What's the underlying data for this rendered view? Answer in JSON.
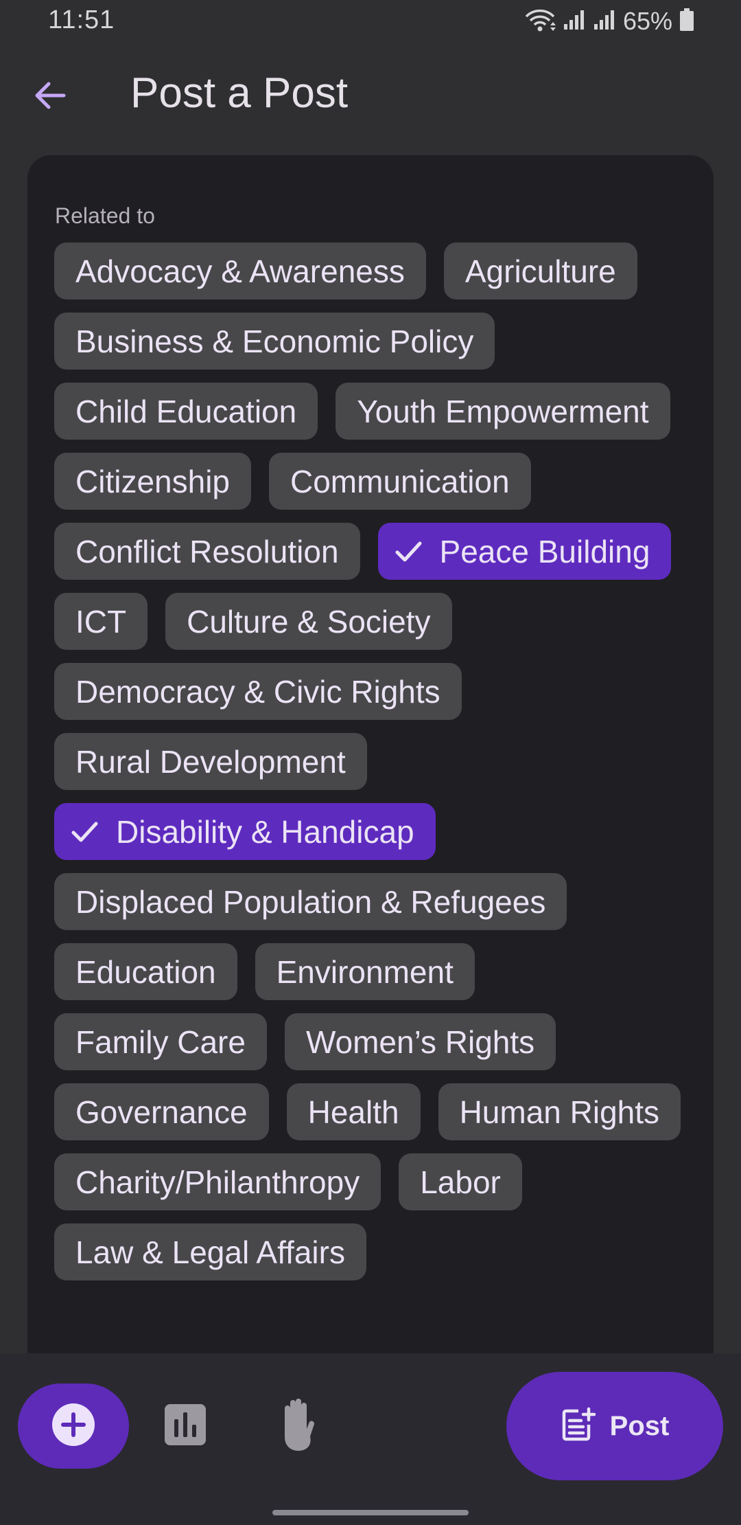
{
  "status_bar": {
    "time": "11:51",
    "battery": "65%"
  },
  "header": {
    "title": "Post a Post",
    "back_icon": "arrow-back-icon"
  },
  "form": {
    "related_label": "Related to",
    "chips": [
      {
        "label": "Advocacy & Awareness",
        "selected": false
      },
      {
        "label": "Agriculture",
        "selected": false
      },
      {
        "label": "Business & Economic Policy",
        "selected": false
      },
      {
        "label": "Child Education",
        "selected": false
      },
      {
        "label": "Youth Empowerment",
        "selected": false
      },
      {
        "label": "Citizenship",
        "selected": false
      },
      {
        "label": "Communication",
        "selected": false
      },
      {
        "label": "Conflict Resolution",
        "selected": false
      },
      {
        "label": "Peace Building",
        "selected": true
      },
      {
        "label": "ICT",
        "selected": false
      },
      {
        "label": "Culture & Society",
        "selected": false
      },
      {
        "label": "Democracy & Civic Rights",
        "selected": false
      },
      {
        "label": "Rural Development",
        "selected": false
      },
      {
        "label": "Disability & Handicap",
        "selected": true
      },
      {
        "label": "Displaced Population & Refugees",
        "selected": false
      },
      {
        "label": "Education",
        "selected": false
      },
      {
        "label": "Environment",
        "selected": false
      },
      {
        "label": "Family Care",
        "selected": false
      },
      {
        "label": "Women’s Rights",
        "selected": false
      },
      {
        "label": "Governance",
        "selected": false
      },
      {
        "label": "Health",
        "selected": false
      },
      {
        "label": "Human Rights",
        "selected": false
      },
      {
        "label": "Charity/Philanthropy",
        "selected": false
      },
      {
        "label": "Labor",
        "selected": false
      },
      {
        "label": "Law & Legal Affairs",
        "selected": false
      }
    ]
  },
  "bottom_bar": {
    "post_label": "Post",
    "add_icon": "add-circle-icon",
    "stats_icon": "bar-chart-icon",
    "hand_icon": "hand-icon",
    "post_icon": "post-add-icon"
  },
  "colors": {
    "background": "#2f2f31",
    "card": "#1f1e22",
    "chip": "#48484a",
    "chip_selected": "#5e2bbf",
    "accent": "#5d2bb8",
    "back_arrow": "#c5a8f5"
  }
}
